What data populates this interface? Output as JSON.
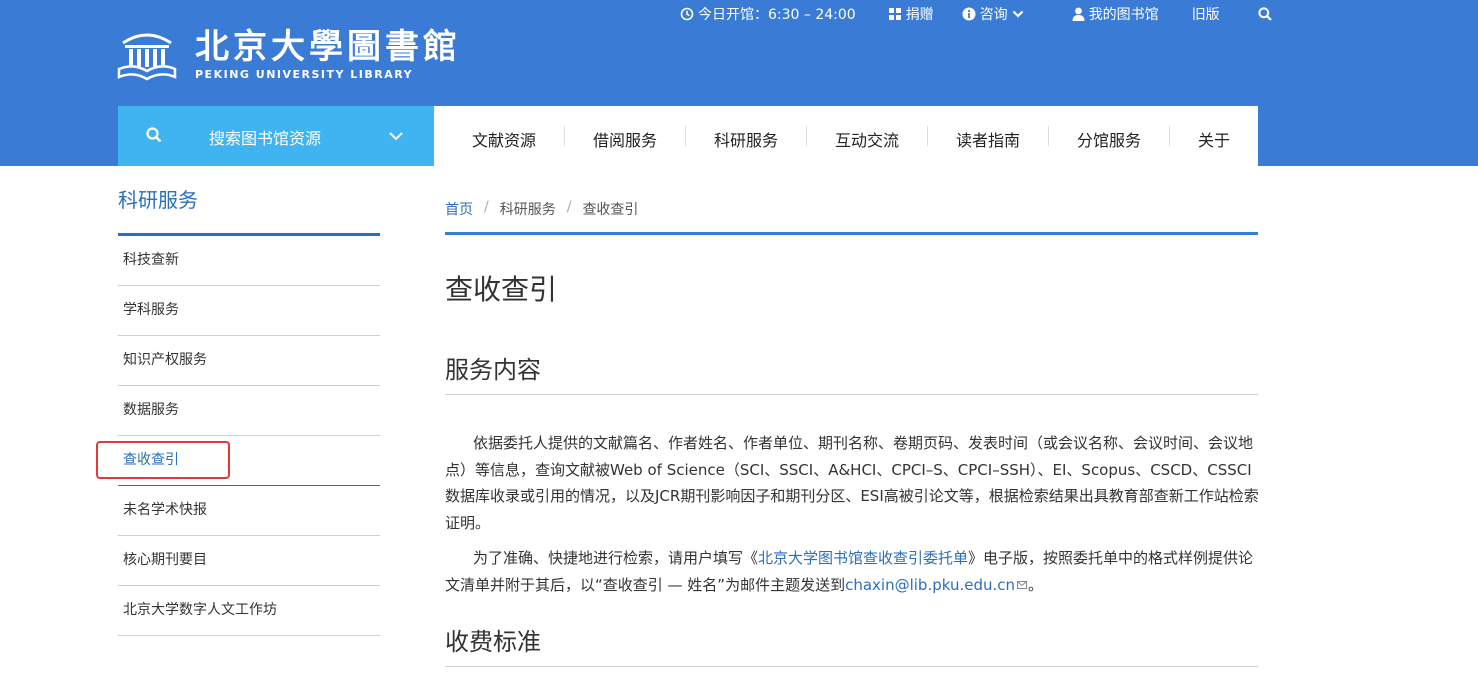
{
  "logo": {
    "cn": "北京大學圖書館",
    "en": "PEKING UNIVERSITY LIBRARY"
  },
  "topbar": {
    "hours": "今日开馆：6:30 – 24:00",
    "donate": "捐赠",
    "consult": "咨询",
    "my_library": "我的图书馆",
    "old_version": "旧版"
  },
  "search": {
    "label": "搜索图书馆资源"
  },
  "nav": [
    "文献资源",
    "借阅服务",
    "科研服务",
    "互动交流",
    "读者指南",
    "分馆服务",
    "关于"
  ],
  "sidebar": {
    "title": "科研服务",
    "items": [
      "科技查新",
      "学科服务",
      "知识产权服务",
      "数据服务",
      "查收查引",
      "未名学术快报",
      "核心期刊要目",
      "北京大学数字人文工作坊"
    ]
  },
  "breadcrumb": [
    "首页",
    "科研服务",
    "查收查引"
  ],
  "page_title": "查收查引",
  "section1": {
    "title": "服务内容",
    "p1": "依据委托人提供的文献篇名、作者姓名、作者单位、期刊名称、卷期页码、发表时间（或会议名称、会议时间、会议地点）等信息，查询文献被Web of Science（SCI、SSCI、A&HCI、CPCI–S、CPCI–SSH）、EI、Scopus、CSCD、CSSCI数据库收录或引用的情况，以及JCR期刊影响因子和期刊分区、ESI高被引论文等，根据检索结果出具教育部查新工作站检索证明。",
    "p2_a": "为了准确、快捷地进行检索，请用户填写《",
    "p2_link": "北京大学图书馆查收查引委托单",
    "p2_b": "》电子版，按照委托单中的格式样例提供论文清单并附于其后，以“查收查引 — 姓名”为邮件主题发送到",
    "p2_email": "chaxin@lib.pku.edu.cn",
    "p2_end": "。"
  },
  "section2": {
    "title": "收费标准"
  },
  "colors": {
    "header_blue": "#3a7bd5",
    "search_blue": "#3fb4f0",
    "link_blue": "#2a6ebd",
    "highlight_red": "#e53935"
  }
}
